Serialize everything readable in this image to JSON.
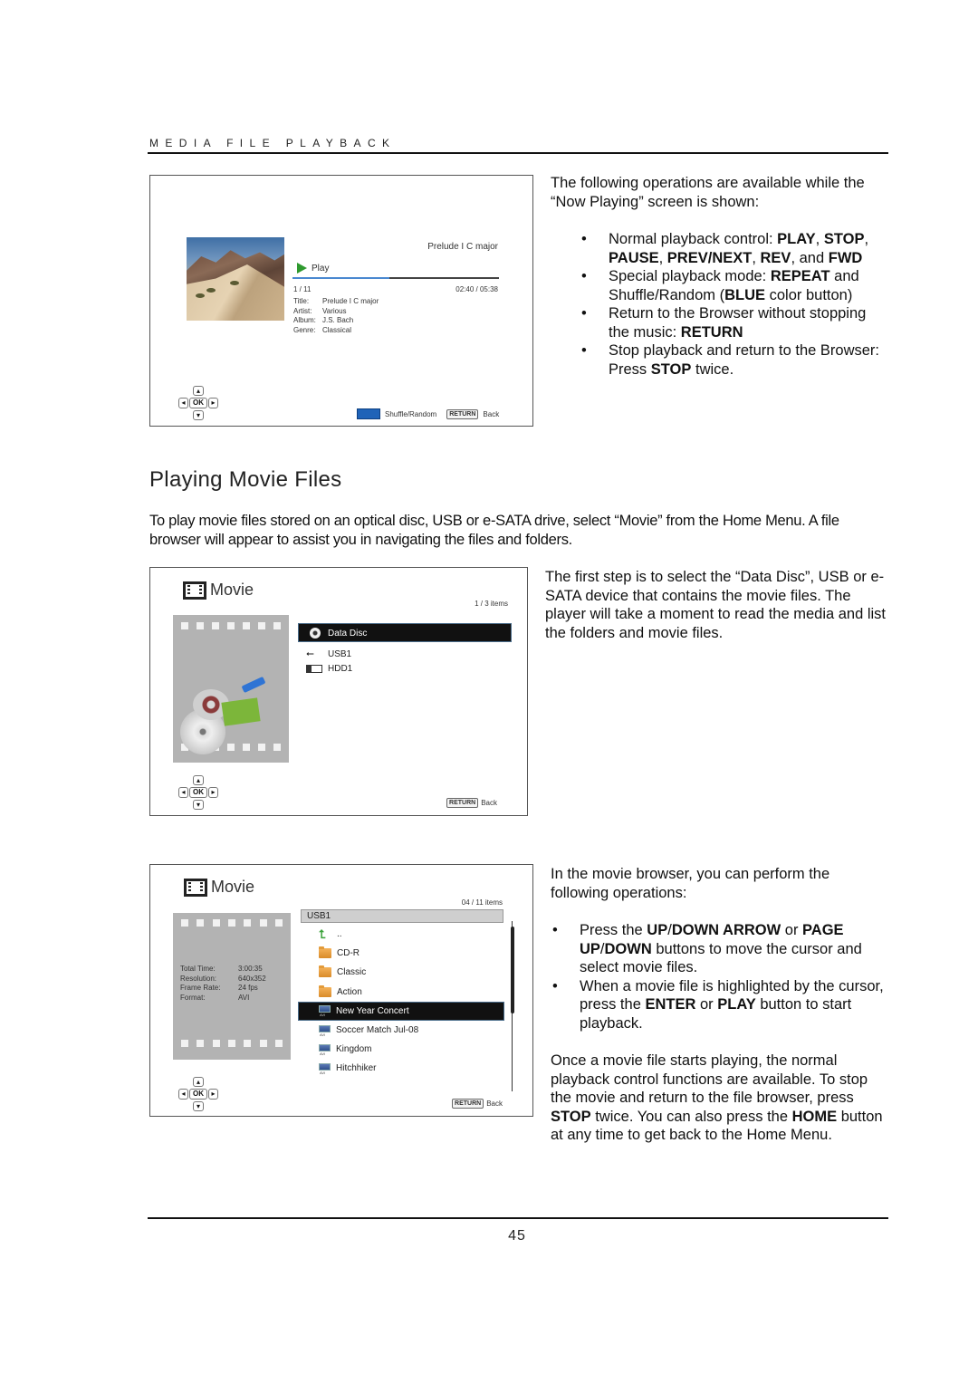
{
  "header": {
    "section_title": "MEDIA FILE PLAYBACK"
  },
  "now_playing_screen": {
    "track_name": "Prelude I C major",
    "status_label": "Play",
    "progress_fraction": 0.47,
    "track_index": "1 / 11",
    "time": "02:40 / 05:38",
    "meta": [
      {
        "label": "Title:",
        "value": "Prelude I C major"
      },
      {
        "label": "Artist:",
        "value": "Various"
      },
      {
        "label": "Album:",
        "value": "J.S. Bach"
      },
      {
        "label": "Genre:",
        "value": "Classical"
      }
    ],
    "shuffle_label": "Shuffle/Random",
    "return_key": "RETURN",
    "back_label": "Back",
    "blue_button_color": "#1f63b8",
    "dpad_ok": "OK"
  },
  "now_playing_text": {
    "intro": "The following operations are available while the “Now Playing” screen is shown:",
    "bullets": [
      [
        "Normal playback control: ",
        "<b>PLAY</b>",
        ", ",
        "<b>STOP</b>",
        ", ",
        "<b>PAUSE</b>",
        ", ",
        "<b>PREV/NEXT</b>",
        ", ",
        "<b>REV</b>",
        ", and ",
        "<b>FWD</b>"
      ],
      [
        "Special playback mode: ",
        "<b>REPEAT</b>",
        " and Shuffle/Random (",
        "<b>BLUE</b>",
        " color button)"
      ],
      [
        "Return to the Browser without stopping the music: ",
        "<b>RETURN</b>"
      ],
      [
        "Stop playback and return to the Browser: Press ",
        "<b>STOP</b>",
        " twice."
      ]
    ]
  },
  "section": {
    "heading": "Playing Movie Files",
    "intro": "To play movie files stored on an optical disc, USB or e-SATA drive, select “Movie” from the Home Menu.  A file browser will appear to assist you in navigating the files and folders."
  },
  "movie_screen_1": {
    "title": "Movie",
    "count": "1 / 3 items",
    "items": [
      {
        "icon": "disc-icon",
        "label": "Data Disc",
        "selected": true
      },
      {
        "icon": "usb-icon",
        "label": "USB1",
        "selected": false
      },
      {
        "icon": "hdd-icon",
        "label": "HDD1",
        "selected": false
      }
    ],
    "return_key": "RETURN",
    "back_label": "Back",
    "dpad_ok": "OK"
  },
  "movie_screen_1_text": "The first step is to select the “Data Disc”, USB or e-SATA device that contains the movie files.  The player will take a moment to read the media and list the folders and movie files.",
  "movie_screen_2": {
    "title": "Movie",
    "count": "04 / 11 items",
    "path": "USB1",
    "info": [
      {
        "label": "Total Time:",
        "value": "3:00:35"
      },
      {
        "label": "Resolution:",
        "value": "640x352"
      },
      {
        "label": "Frame Rate:",
        "value": "24 fps"
      },
      {
        "label": "Format:",
        "value": "AVI"
      }
    ],
    "items": [
      {
        "type": "up",
        "label": ".."
      },
      {
        "type": "folder",
        "label": "CD-R"
      },
      {
        "type": "folder",
        "label": "Classic"
      },
      {
        "type": "folder",
        "label": "Action"
      },
      {
        "type": "avi",
        "label": "New Year Concert",
        "selected": true
      },
      {
        "type": "avi",
        "label": "Soccer Match Jul-08"
      },
      {
        "type": "avi",
        "label": "Kingdom"
      },
      {
        "type": "avi",
        "label": "Hitchhiker"
      }
    ],
    "avi_tag": "AVI",
    "return_key": "RETURN",
    "back_label": "Back",
    "dpad_ok": "OK"
  },
  "movie_screen_2_text": {
    "intro": "In the movie browser, you can perform the following operations:",
    "bullets": [
      [
        "Press the ",
        "<b>UP</b>",
        "/",
        "<b>DOWN ARROW</b>",
        " or ",
        "<b>PAGE UP</b>",
        "/",
        "<b>DOWN</b>",
        " buttons to move the cursor and select movie files."
      ],
      [
        "When a movie file is highlighted by the cursor, press the ",
        "<b>ENTER</b>",
        " or ",
        "<b>PLAY</b>",
        " button to start playback."
      ]
    ],
    "outro": [
      "Once a movie file starts playing, the normal playback control functions are available.  To stop the movie and return to the file browser, press ",
      "<b>STOP</b>",
      " twice.  You can also press the ",
      "<b>HOME</b>",
      " button at any time to get back to the Home Menu."
    ]
  },
  "footer": {
    "page_number": "45"
  }
}
